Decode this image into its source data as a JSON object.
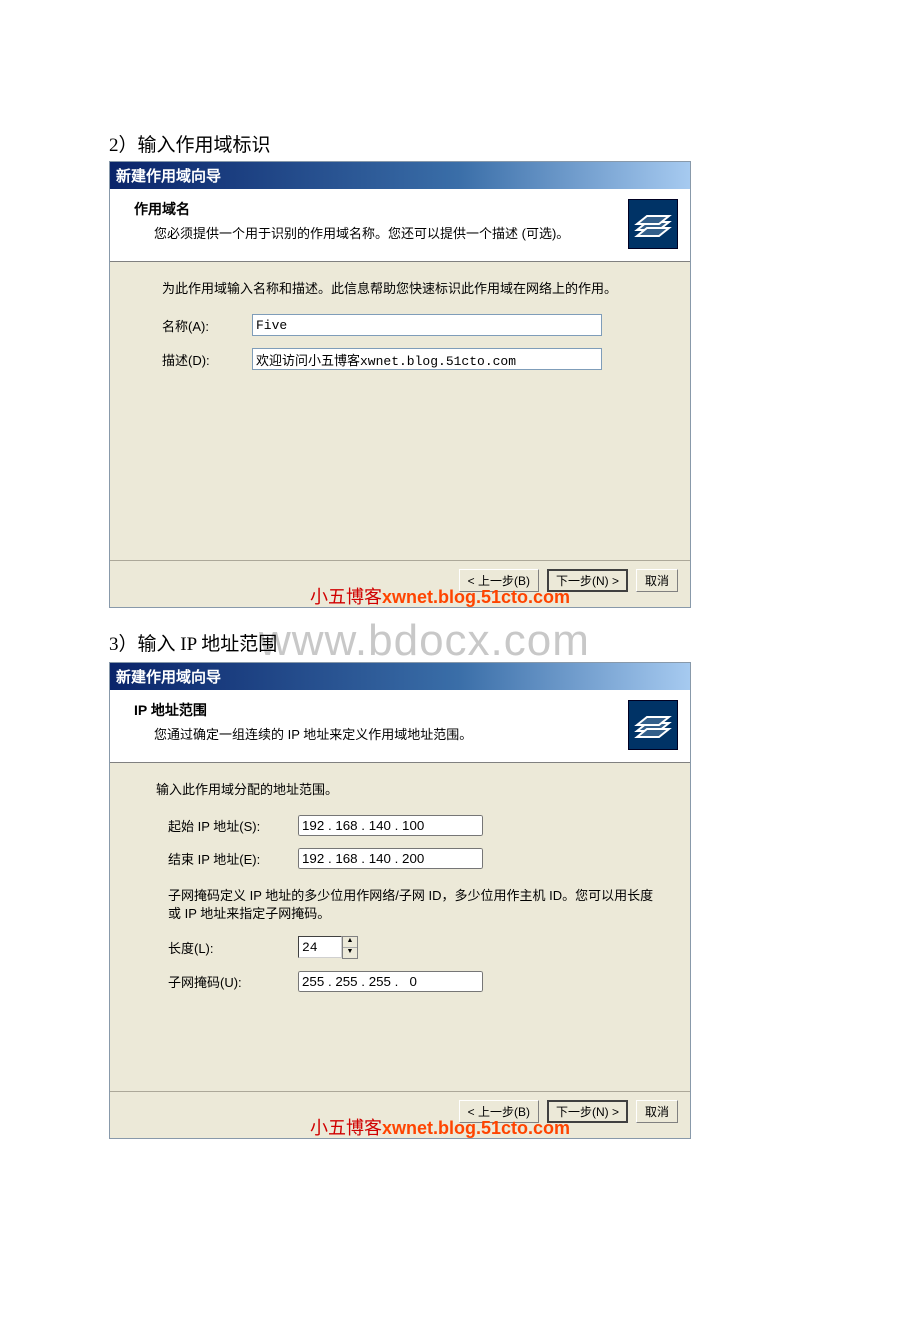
{
  "section1": {
    "caption": "2）输入作用域标识",
    "wizard_title": "新建作用域向导",
    "header_title": "作用域名",
    "header_sub": "您必须提供一个用于识别的作用域名称。您还可以提供一个描述 (可选)。",
    "body_instr": "为此作用域输入名称和描述。此信息帮助您快速标识此作用域在网络上的作用。",
    "name_label": "名称(A):",
    "name_value": "Five",
    "desc_label": "描述(D):",
    "desc_value": "欢迎访问小五博客xwnet.blog.51cto.com",
    "btn_back": "< 上一步(B)",
    "btn_next": "下一步(N) >",
    "btn_cancel": "取消"
  },
  "watermark_red_cn": "小五博客",
  "watermark_red_en": "xwnet.blog.51cto.com",
  "watermark_big": "www.bdocx.com",
  "section2": {
    "caption": "3）输入 IP 地址范围",
    "wizard_title": "新建作用域向导",
    "header_title": "IP 地址范围",
    "header_sub": "您通过确定一组连续的 IP 地址来定义作用域地址范围。",
    "body_instr1": "输入此作用域分配的地址范围。",
    "start_label": "起始 IP 地址(S):",
    "start_value": "192 . 168 . 140 . 100",
    "end_label": "结束 IP 地址(E):",
    "end_value": "192 . 168 . 140 . 200",
    "body_instr2": "子网掩码定义 IP 地址的多少位用作网络/子网 ID，多少位用作主机 ID。您可以用长度或 IP 地址来指定子网掩码。",
    "len_label": "长度(L):",
    "len_value": "24",
    "mask_label": "子网掩码(U):",
    "mask_value": "255 . 255 . 255 .   0",
    "btn_back": "< 上一步(B)",
    "btn_next": "下一步(N) >",
    "btn_cancel": "取消"
  }
}
